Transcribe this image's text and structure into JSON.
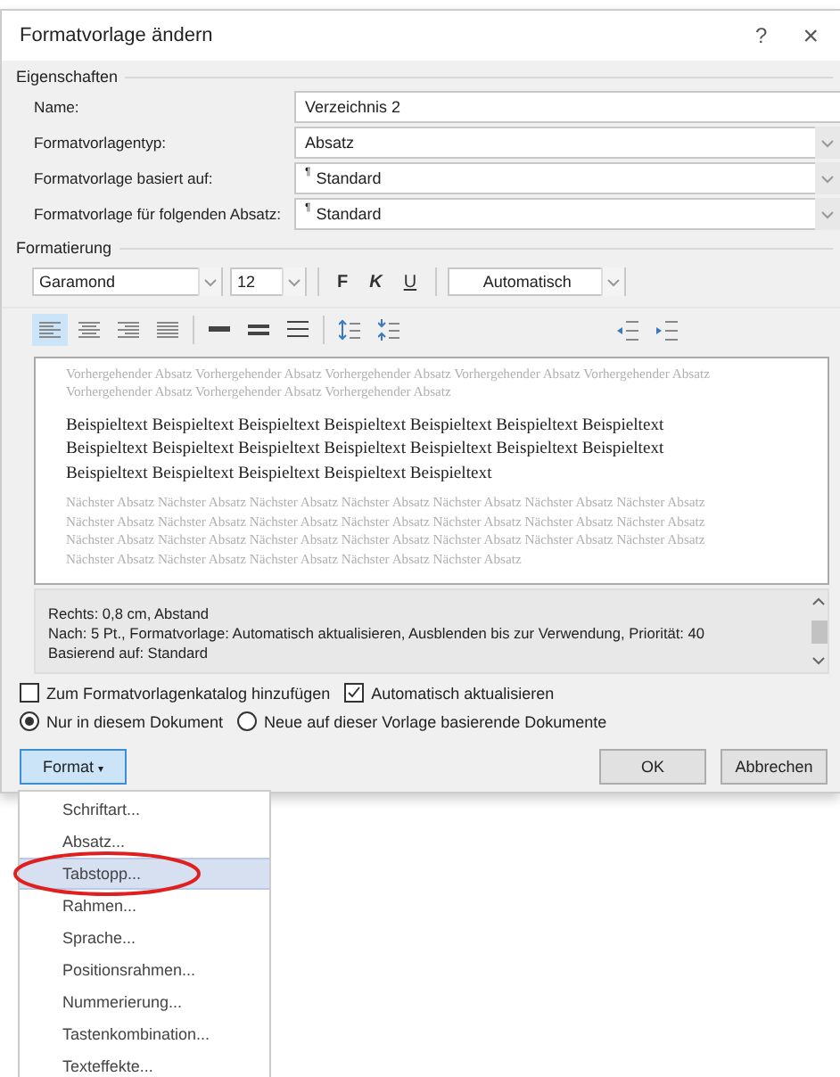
{
  "window": {
    "title": "Formatvorlage ändern",
    "help": "?",
    "close": "×"
  },
  "properties": {
    "heading": "Eigenschaften",
    "fields": [
      {
        "label": "Name:",
        "value": "Verzeichnis 2",
        "kind": "text"
      },
      {
        "label": "Formatvorlagentyp:",
        "value": "Absatz",
        "kind": "dropdown"
      },
      {
        "label": "Formatvorlage basiert auf:",
        "value": "Standard",
        "kind": "dropdown",
        "mark": "¶"
      },
      {
        "label": "Formatvorlage für folgenden Absatz:",
        "value": "Standard",
        "kind": "dropdown",
        "mark": "¶"
      }
    ]
  },
  "formatting": {
    "heading": "Formatierung",
    "font": "Garamond",
    "size": "12",
    "bold": "F",
    "italic": "K",
    "underline": "U",
    "font_color_label": "Automatisch",
    "align": [
      {
        "kind": "left",
        "selected": true
      },
      {
        "kind": "center",
        "selected": false
      },
      {
        "kind": "right",
        "selected": false
      },
      {
        "kind": "justify",
        "selected": false
      }
    ],
    "preview": {
      "previous": "Vorhergehender Absatz Vorhergehender Absatz Vorhergehender Absatz Vorhergehender Absatz Vorhergehender Absatz Vorhergehender Absatz Vorhergehender Absatz Vorhergehender Absatz",
      "sample": "Beispieltext Beispieltext Beispieltext Beispieltext Beispieltext Beispieltext Beispieltext Beispieltext Beispieltext Beispieltext Beispieltext Beispieltext Beispieltext Beispieltext Beispieltext Beispieltext Beispieltext Beispieltext Beispieltext",
      "next": "Nächster Absatz Nächster Absatz Nächster Absatz Nächster Absatz Nächster Absatz Nächster Absatz Nächster Absatz Nächster Absatz Nächster Absatz Nächster Absatz Nächster Absatz Nächster Absatz Nächster Absatz Nächster Absatz Nächster Absatz Nächster Absatz Nächster Absatz Nächster Absatz Nächster Absatz Nächster Absatz Nächster Absatz Nächster Absatz Nächster Absatz Nächster Absatz Nächster Absatz Nächster Absatz"
    },
    "description": [
      "Rechts:  0,8 cm, Abstand",
      "Nach:  5 Pt., Formatvorlage: Automatisch aktualisieren, Ausblenden bis zur Verwendung, Priorität: 40",
      "Basierend auf: Standard"
    ]
  },
  "checkboxes": [
    {
      "label": "Zum Formatvorlagenkatalog hinzufügen",
      "checked": false
    },
    {
      "label": "Automatisch aktualisieren",
      "checked": true
    }
  ],
  "radios": [
    {
      "label": "Nur in diesem Dokument",
      "selected": true
    },
    {
      "label": "Neue auf dieser Vorlage basierende Dokumente",
      "selected": false
    }
  ],
  "buttons": {
    "format": "Format",
    "format_caret": "▾",
    "ok": "OK",
    "cancel": "Abbrechen"
  },
  "format_menu": [
    {
      "label": "Schriftart...",
      "selected": false,
      "circled": false
    },
    {
      "label": "Absatz...",
      "selected": false,
      "circled": false
    },
    {
      "label": "Tabstopp...",
      "selected": true,
      "circled": true
    },
    {
      "label": "Rahmen...",
      "selected": false,
      "circled": false
    },
    {
      "label": "Sprache...",
      "selected": false,
      "circled": false
    },
    {
      "label": "Positionsrahmen...",
      "selected": false,
      "circled": false
    },
    {
      "label": "Nummerierung...",
      "selected": false,
      "circled": false
    },
    {
      "label": "Tastenkombination...",
      "selected": false,
      "circled": false
    },
    {
      "label": "Texteffekte...",
      "selected": false,
      "circled": false
    }
  ]
}
